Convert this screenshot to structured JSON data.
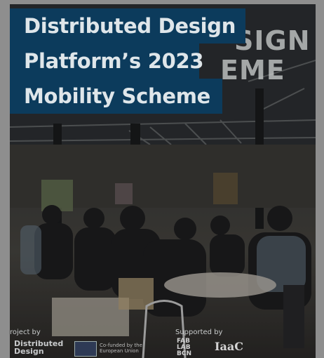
{
  "title": {
    "line1": "Distributed Design",
    "line2": "Platform’s 2023",
    "line3": "Mobility Scheme"
  },
  "background_sign": {
    "line1": "SIGN",
    "line2": "EME"
  },
  "footer": {
    "project_by_label": "roject by",
    "distributed_design_logo_line1": "Distributed",
    "distributed_design_logo_line2": "Design",
    "eu_text_line1": "Co-funded by the",
    "eu_text_line2": "European Union",
    "supported_by_label": "Supported by",
    "fab_logo_line1": "FAB",
    "fab_logo_line2": "LAB",
    "fab_logo_line3": "BCN",
    "iaac_logo": "IaaC"
  },
  "colors": {
    "title_background": "#0c3b5c",
    "title_text": "#dfe6ea",
    "page_background": "#8e8e8e"
  }
}
